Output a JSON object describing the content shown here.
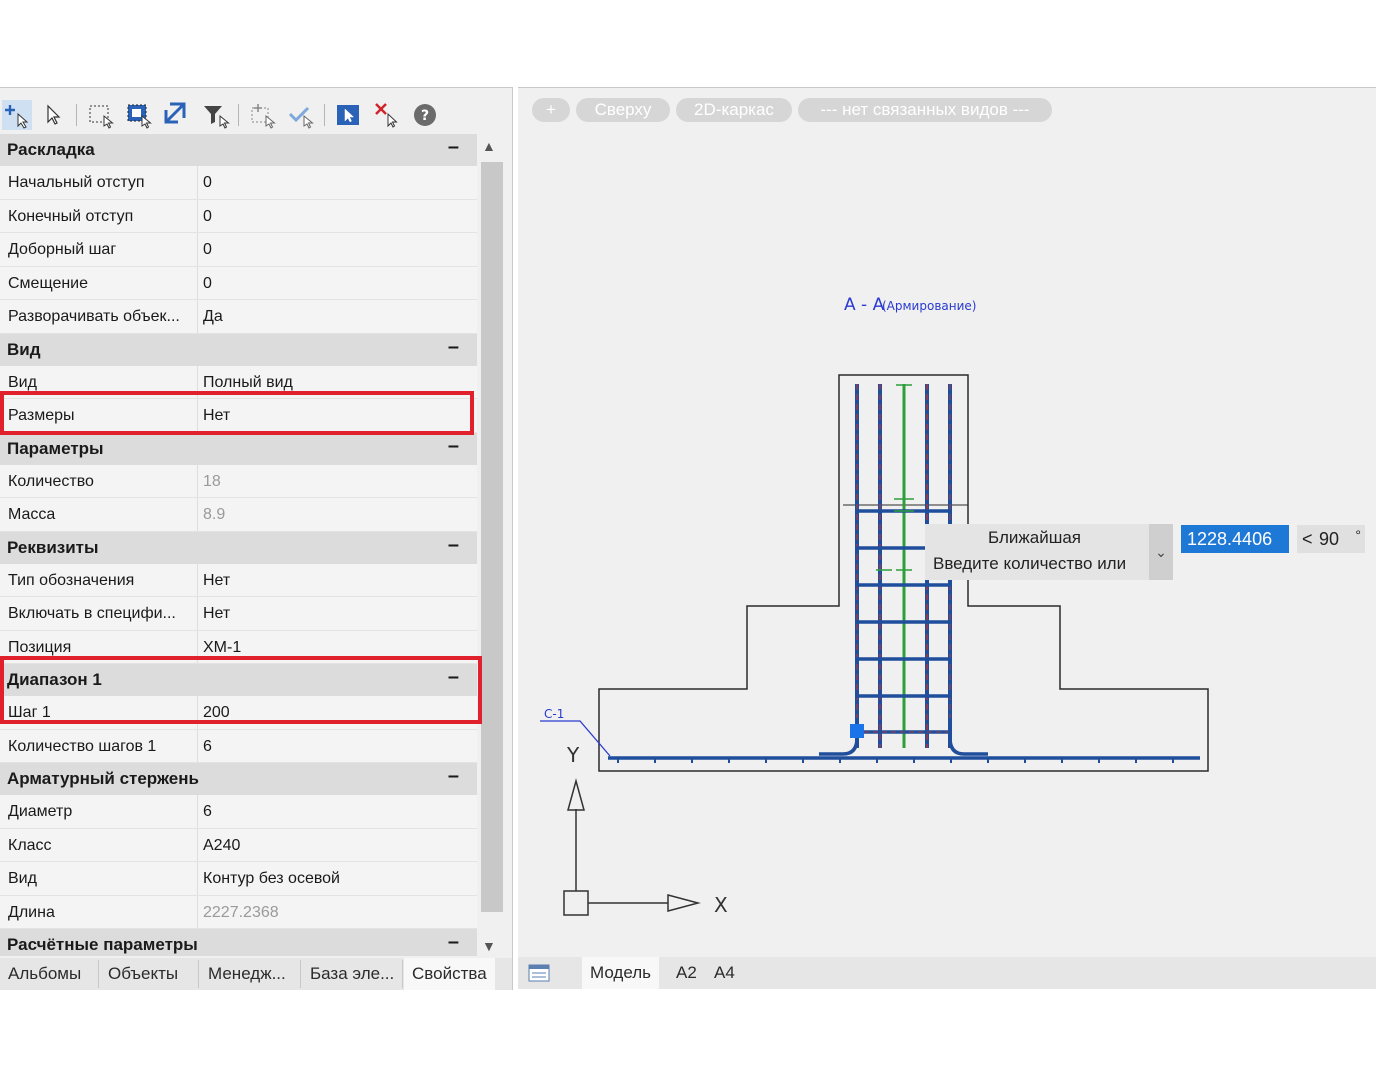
{
  "toolbar": {
    "icons": [
      "add-select-icon",
      "pointer-icon",
      "select-window-icon",
      "select-all-icon",
      "invert-select-icon",
      "filter-select-icon",
      "select-group-icon",
      "confirm-select-icon",
      "active-select-icon",
      "clear-select-icon",
      "help-icon"
    ]
  },
  "properties": [
    {
      "category": "Раскладка",
      "collapse": "–",
      "rows": [
        {
          "label": "Начальный отступ",
          "value": "0",
          "readonly": false
        },
        {
          "label": "Конечный отступ",
          "value": "0",
          "readonly": false
        },
        {
          "label": "Доборный шаг",
          "value": "0",
          "readonly": false
        },
        {
          "label": "Смещение",
          "value": "0",
          "readonly": false
        },
        {
          "label": "Разворачивать объек...",
          "value": "Да",
          "readonly": false
        }
      ]
    },
    {
      "category": "Вид",
      "collapse": "–",
      "rows": [
        {
          "label": "Вид",
          "value": "Полный вид",
          "readonly": false
        },
        {
          "label": "Размеры",
          "value": "Нет",
          "readonly": false
        }
      ]
    },
    {
      "category": "Параметры",
      "collapse": "–",
      "rows": [
        {
          "label": "Количество",
          "value": "18",
          "readonly": true
        },
        {
          "label": "Масса",
          "value": "8.9",
          "readonly": true
        }
      ]
    },
    {
      "category": "Реквизиты",
      "collapse": "–",
      "rows": [
        {
          "label": "Тип обозначения",
          "value": "Нет",
          "readonly": false
        },
        {
          "label": "Включать в специфи...",
          "value": "Нет",
          "readonly": false
        },
        {
          "label": "Позиция",
          "value": "ХМ-1",
          "readonly": false
        }
      ]
    },
    {
      "category": "Диапазон 1",
      "collapse": "–",
      "rows": [
        {
          "label": "Шаг 1",
          "value": "200",
          "readonly": false
        },
        {
          "label": "Количество шагов 1",
          "value": "6",
          "readonly": false
        }
      ]
    },
    {
      "category": "Арматурный стержень",
      "collapse": "–",
      "rows": [
        {
          "label": "Диаметр",
          "value": "6",
          "readonly": false
        },
        {
          "label": "Класс",
          "value": "A240",
          "readonly": false
        },
        {
          "label": "Вид",
          "value": "Контур без осевой",
          "readonly": false
        },
        {
          "label": "Длина",
          "value": "2227.2368",
          "readonly": true
        }
      ]
    },
    {
      "category": "Расчётные параметры",
      "collapse": "–",
      "rows": []
    }
  ],
  "panel_tabs": [
    "Альбомы",
    "Объекты",
    "Менедж...",
    "База эле...",
    "Свойства"
  ],
  "active_panel_tab": "Свойства",
  "viewport": {
    "view_controls": [
      "+",
      "Сверху",
      "2D-каркас",
      "--- нет связанных видов ---"
    ],
    "section_title": "А - А",
    "section_subtitle": "(Армирование)",
    "marker_label": "С-1",
    "axis_y": "Y",
    "axis_x": "X",
    "tooltip_line1": "Ближайшая",
    "tooltip_line2": "Введите количество или",
    "input_value": "1228.4406",
    "angle_prefix": "<",
    "angle_value": "90",
    "angle_unit": "°"
  },
  "layout_tabs": [
    "Модель",
    "A2",
    "A4"
  ],
  "active_layout_tab": "Модель",
  "colors": {
    "highlight": "#e0202a",
    "rebar_blue": "#1f4e9c",
    "rebar_red": "#c0392b",
    "rebar_green": "#2e9e3a",
    "input_blue": "#1e78d6"
  }
}
